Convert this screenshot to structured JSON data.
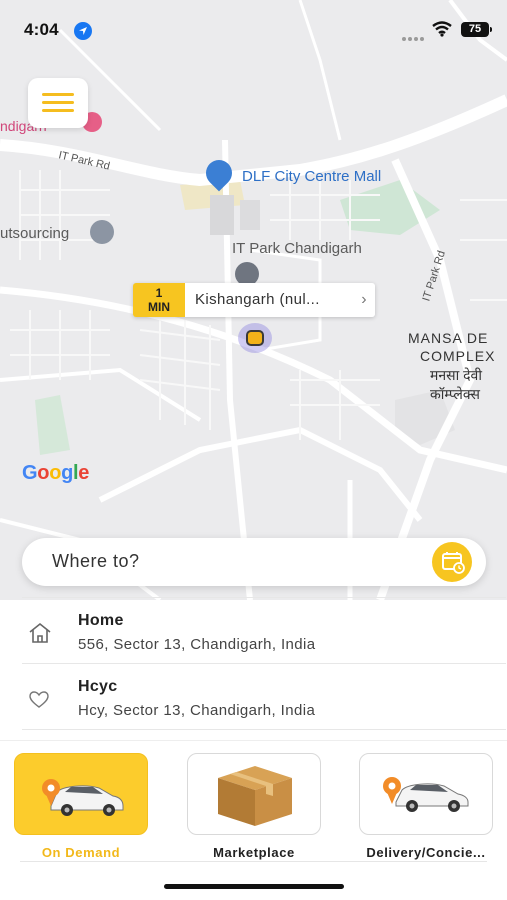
{
  "status_bar": {
    "time": "4:04",
    "battery": "75"
  },
  "map": {
    "labels": {
      "chandigarh": "ndigarh",
      "it_park_rd": "IT Park Rd",
      "dlf_mall": "DLF City Centre Mall",
      "outsourcing": "utsourcing",
      "it_park": "IT Park Chandigarh",
      "it_park_rd_vertical": "IT Park Rd",
      "mansa_1": "MANSA DE",
      "mansa_2": "COMPLEX",
      "mansa_hi_1": "मनसा देवी",
      "mansa_hi_2": "कॉम्प्लेक्स",
      "google": [
        "G",
        "o",
        "o",
        "g",
        "l",
        "e"
      ]
    },
    "pickup": {
      "eta_value": "1",
      "eta_unit": "MIN",
      "place": "Kishangarh (nul..."
    }
  },
  "search": {
    "placeholder": "Where to?"
  },
  "saved_places": [
    {
      "icon": "home-icon",
      "title": "Home",
      "address": "556, Sector 13, Chandigarh, India"
    },
    {
      "icon": "heart-icon",
      "title": "Hcyc",
      "address": "Hcy, Sector 13, Chandigarh, India"
    }
  ],
  "services": [
    {
      "label": "On Demand",
      "active": true,
      "icon": "car-icon"
    },
    {
      "label": "Marketplace",
      "active": false,
      "icon": "box-icon"
    },
    {
      "label": "Delivery/Concie...",
      "active": false,
      "icon": "car-icon"
    }
  ],
  "colors": {
    "accent": "#f7c520",
    "map_bg": "#ebebed",
    "link_blue": "#2d6fc6"
  }
}
